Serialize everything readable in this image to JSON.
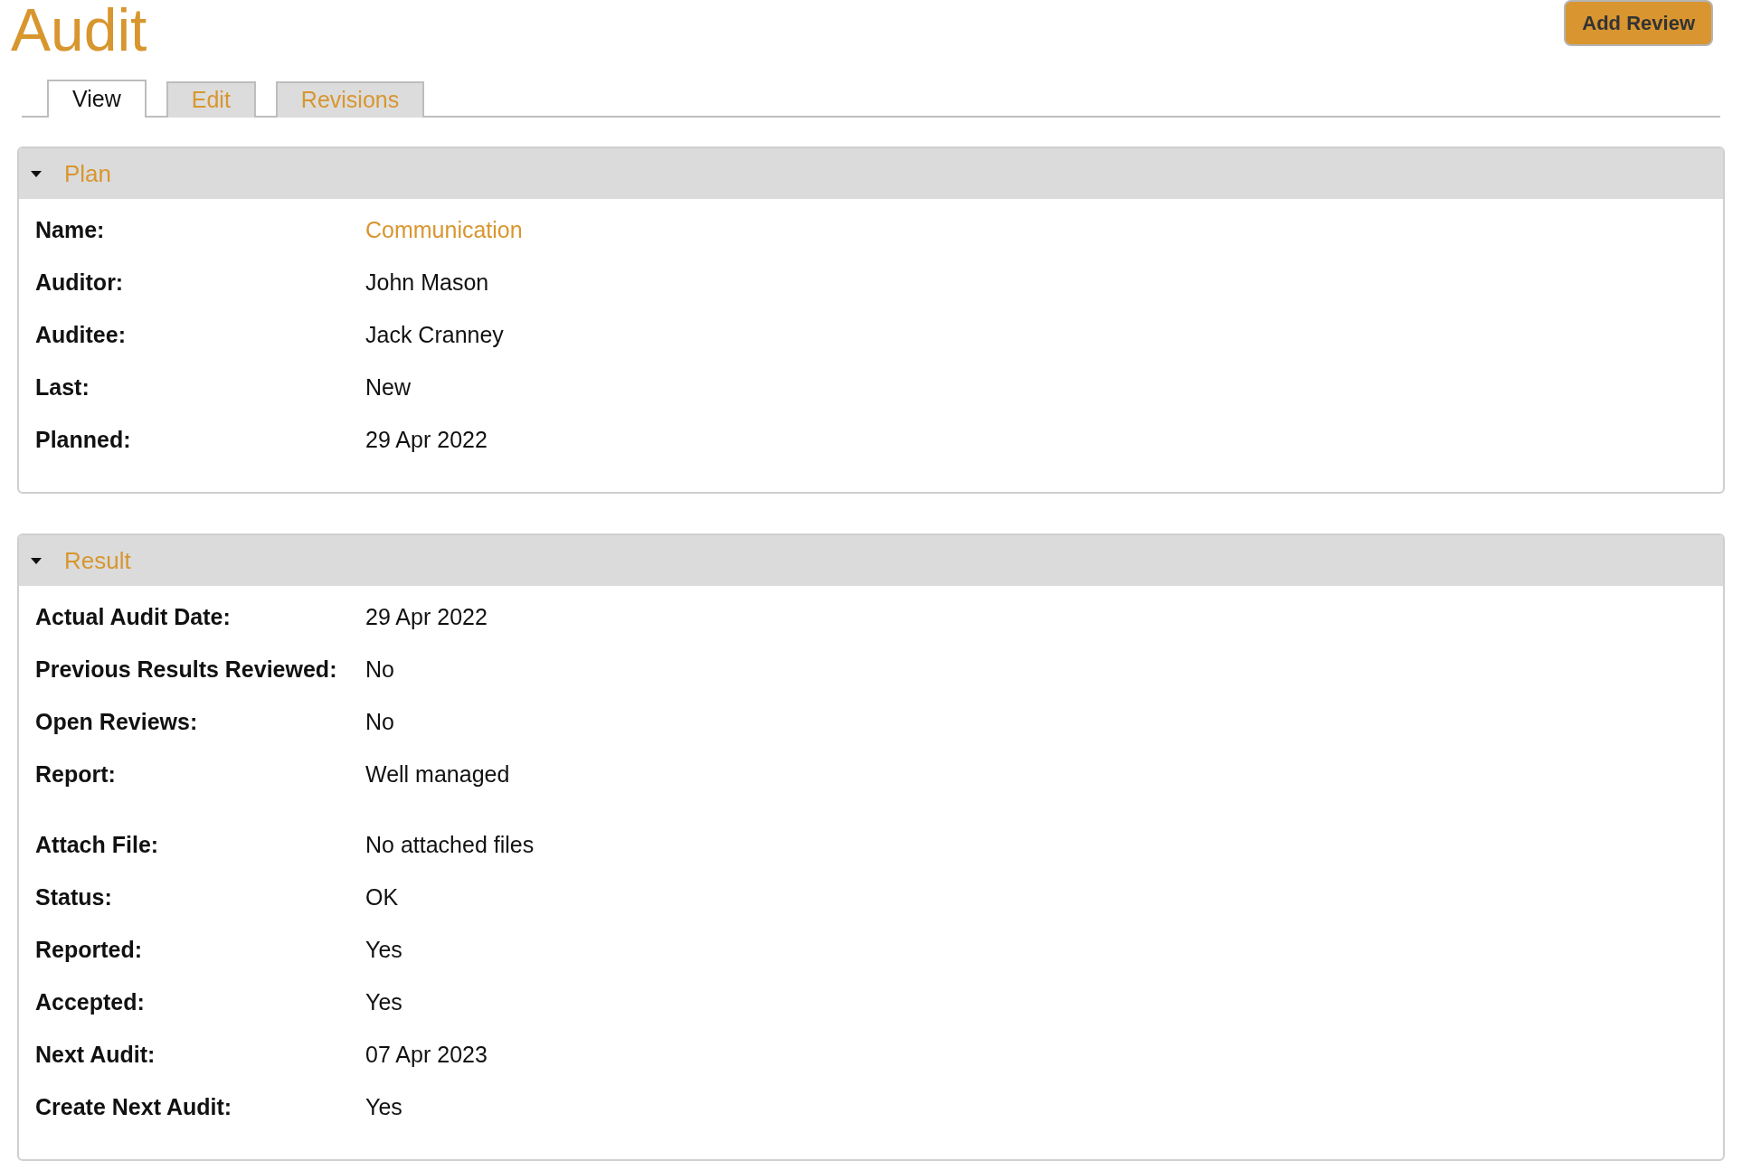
{
  "title": "Audit",
  "action_button": {
    "label": "Add Review"
  },
  "tabs": [
    {
      "label": "View",
      "selected": true
    },
    {
      "label": "Edit",
      "selected": false
    },
    {
      "label": "Revisions",
      "selected": false
    }
  ],
  "sections": [
    {
      "title": "Plan",
      "expanded": true,
      "fields": [
        {
          "label": "Name:",
          "value": "Communication",
          "kind": "link"
        },
        {
          "label": "Auditor:",
          "value": "John Mason",
          "kind": "text"
        },
        {
          "label": "Auditee:",
          "value": "Jack Cranney",
          "kind": "text"
        },
        {
          "label": "Last:",
          "value": "New",
          "kind": "text"
        },
        {
          "label": "Planned:",
          "value": "29 Apr 2022",
          "kind": "text"
        }
      ]
    },
    {
      "title": "Result",
      "expanded": true,
      "fields": [
        {
          "label": "Actual Audit Date:",
          "value": "29 Apr 2022",
          "kind": "text"
        },
        {
          "label": "Previous Results Reviewed:",
          "value": "No",
          "kind": "text"
        },
        {
          "label": "Open Reviews:",
          "value": "No",
          "kind": "text"
        },
        {
          "label": "Report:",
          "value": "Well managed",
          "kind": "paragraph"
        },
        {
          "label": "Attach File:",
          "value": "No attached files",
          "kind": "text"
        },
        {
          "label": "Status:",
          "value": "OK",
          "kind": "text"
        },
        {
          "label": "Reported:",
          "value": "Yes",
          "kind": "text"
        },
        {
          "label": "Accepted:",
          "value": "Yes",
          "kind": "text"
        },
        {
          "label": "Next Audit:",
          "value": "07 Apr 2023",
          "kind": "text"
        },
        {
          "label": "Create Next Audit:",
          "value": "Yes",
          "kind": "text"
        }
      ]
    }
  ]
}
